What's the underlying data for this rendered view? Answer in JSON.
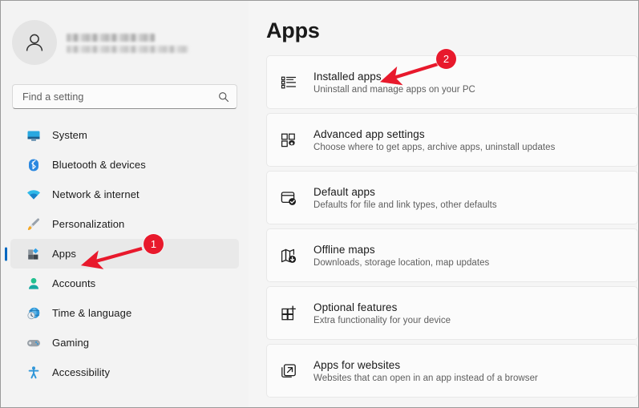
{
  "sidebar": {
    "profile": {
      "avatar_icon": "person-avatar-icon",
      "name_redacted": true,
      "email_redacted": true
    },
    "search": {
      "placeholder": "Find a setting",
      "icon": "search-icon",
      "value": ""
    },
    "items": [
      {
        "label": "System",
        "icon": "monitor-icon",
        "selected": false
      },
      {
        "label": "Bluetooth & devices",
        "icon": "bluetooth-icon",
        "selected": false
      },
      {
        "label": "Network & internet",
        "icon": "wifi-icon",
        "selected": false
      },
      {
        "label": "Personalization",
        "icon": "paintbrush-icon",
        "selected": false
      },
      {
        "label": "Apps",
        "icon": "apps-grid-icon",
        "selected": true
      },
      {
        "label": "Accounts",
        "icon": "person-icon",
        "selected": false
      },
      {
        "label": "Time & language",
        "icon": "globe-clock-icon",
        "selected": false
      },
      {
        "label": "Gaming",
        "icon": "gamepad-icon",
        "selected": false
      },
      {
        "label": "Accessibility",
        "icon": "accessibility-icon",
        "selected": false
      }
    ]
  },
  "main": {
    "title": "Apps",
    "cards": [
      {
        "title": "Installed apps",
        "subtitle": "Uninstall and manage apps on your PC",
        "icon": "list-bullets-icon"
      },
      {
        "title": "Advanced app settings",
        "subtitle": "Choose where to get apps, archive apps, uninstall updates",
        "icon": "grid-gear-icon"
      },
      {
        "title": "Default apps",
        "subtitle": "Defaults for file and link types, other defaults",
        "icon": "window-check-icon"
      },
      {
        "title": "Offline maps",
        "subtitle": "Downloads, storage location, map updates",
        "icon": "map-download-icon"
      },
      {
        "title": "Optional features",
        "subtitle": "Extra functionality for your device",
        "icon": "grid-plus-icon"
      },
      {
        "title": "Apps for websites",
        "subtitle": "Websites that can open in an app instead of a browser",
        "icon": "external-link-icon"
      }
    ]
  },
  "annotations": {
    "color": "#e8192c",
    "markers": [
      {
        "label": "1",
        "points_to": "sidebar-item-apps"
      },
      {
        "label": "2",
        "points_to": "card-installed-apps"
      }
    ]
  },
  "colors": {
    "accent": "#0067c0",
    "annotation_red": "#e8192c",
    "sidebar_bg": "#f3f3f3",
    "main_bg": "#f5f5f5",
    "card_bg": "#fbfbfb"
  }
}
